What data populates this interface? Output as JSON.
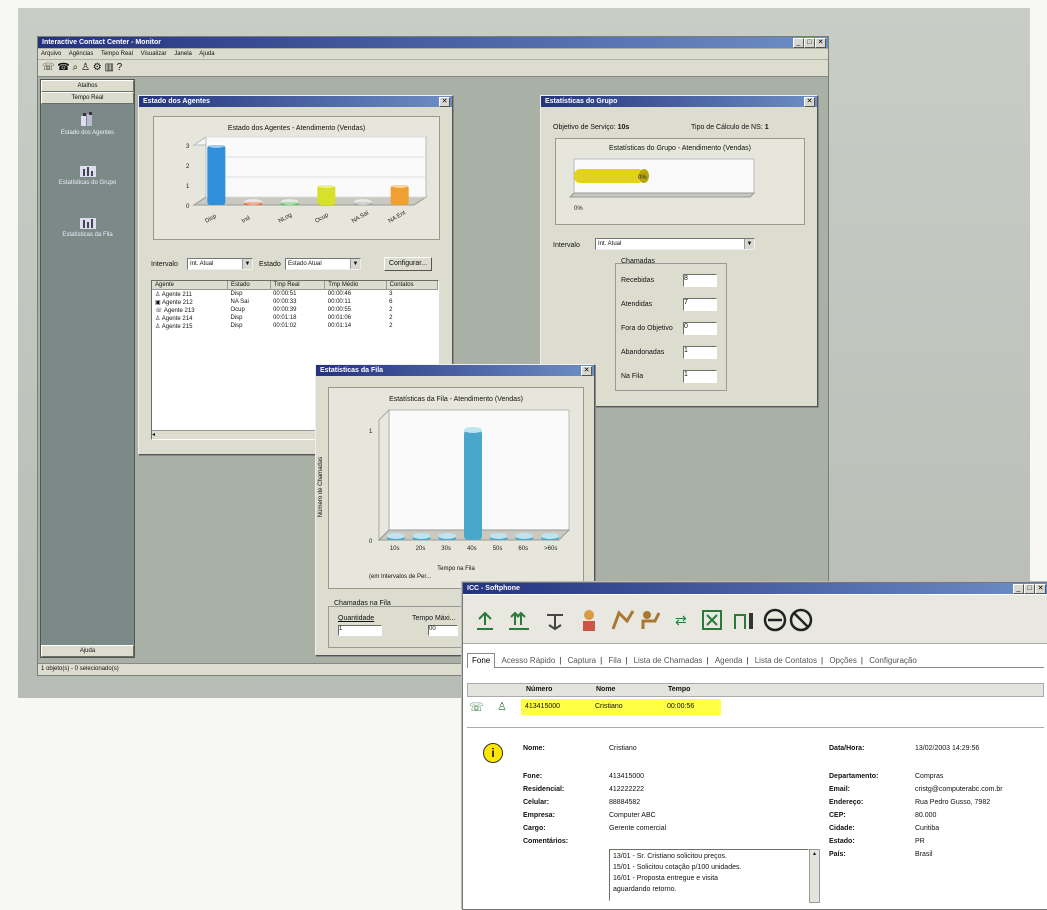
{
  "main_window": {
    "title": "Interactive Contact Center - Monitor",
    "menu": [
      "Arquivo",
      "Agências",
      "Tempo Real",
      "Visualizar",
      "Janela",
      "Ajuda"
    ],
    "sidebar": {
      "header": "Atalhos",
      "section": "Tempo Real",
      "items": [
        {
          "label": "Estado dos Agentes",
          "icon": "agents-icon"
        },
        {
          "label": "Estatísticas do Grupo",
          "icon": "group-stats-icon"
        },
        {
          "label": "Estatísticas da Fila",
          "icon": "queue-stats-icon"
        }
      ],
      "footer": "Ajuda"
    },
    "status_bar": "1 objeto(s) - 0 selecionado(s)"
  },
  "agents_window": {
    "title": "Estado dos Agentes",
    "interval_label": "Intervalo",
    "interval_value": "Int. Atual",
    "state_label": "Estado",
    "state_value": "Estado Atual",
    "configure_button": "Configurar...",
    "chart_data": {
      "type": "bar",
      "title": "Estado dos Agentes - Atendimento (Vendas)",
      "categories": [
        "Disp",
        "Ind",
        "NLog",
        "Ocup",
        "NA Sai",
        "NA Ent"
      ],
      "values": [
        3,
        0,
        0,
        1,
        0,
        1
      ],
      "ylim": [
        0,
        3
      ],
      "yticks": [
        "0",
        "1",
        "2",
        "3"
      ],
      "colors": [
        "#2f8fd8",
        "#e4531f",
        "#3fb84a",
        "#d8e02a",
        "#9a9a9a",
        "#f0a030"
      ]
    },
    "columns": [
      "Agente",
      "Estado",
      "Tmp Real",
      "Tmp Médio",
      "Contatos"
    ],
    "rows": [
      [
        "Agente 211",
        "Disp",
        "00:00:51",
        "00:00:46",
        "3"
      ],
      [
        "Agente 212",
        "NA Sai",
        "00:00:33",
        "00:00:11",
        "6"
      ],
      [
        "Agente 213",
        "Ocup",
        "00:00:39",
        "00:00:55",
        "2"
      ],
      [
        "Agente 214",
        "Disp",
        "00:01:18",
        "00:01:06",
        "2"
      ],
      [
        "Agente 215",
        "Disp",
        "00:01:02",
        "00:01:14",
        "2"
      ]
    ]
  },
  "group_window": {
    "title": "Estatísticas do Grupo",
    "objective_label": "Objetivo de Serviço:",
    "objective_value": "10s",
    "calc_label": "Tipo de Cálculo de NS:",
    "calc_value": "1",
    "chart_data": {
      "type": "bar",
      "title": "Estatísticas do Grupo - Atendimento (Vendas)",
      "categories": [
        ""
      ],
      "values": [
        0
      ],
      "bar_label": "0%",
      "axis_label": "0%"
    },
    "interval_label": "Intervalo",
    "interval_value": "Int. Atual",
    "calls_label": "Chamadas",
    "stats": [
      {
        "label": "Recebidas",
        "value": "8"
      },
      {
        "label": "Atendidas",
        "value": "7"
      },
      {
        "label": "Fora do Objetivo",
        "value": "0"
      },
      {
        "label": "Abandonadas",
        "value": "1"
      },
      {
        "label": "Na Fila",
        "value": "1"
      }
    ]
  },
  "queue_window": {
    "title": "Estatísticas da Fila",
    "chart_data": {
      "type": "bar",
      "title": "Estatísticas da Fila - Atendimento (Vendas)",
      "categories": [
        "10s",
        "20s",
        "30s",
        "40s",
        "50s",
        "60s",
        ">60s"
      ],
      "values": [
        0,
        0,
        0,
        1,
        0,
        0,
        0
      ],
      "ylim": [
        0,
        1
      ],
      "yticks": [
        "0",
        "1"
      ],
      "ylabel": "Número de Chamadas",
      "xlabel": "Tempo na Fila",
      "xlabel2": "(em Intervalos de Per..."
    },
    "calls_label": "Chamadas na Fila",
    "qty_label": "Quantidade",
    "qty_value": "1",
    "max_label": "Tempo Máxi...",
    "max_value": "00"
  },
  "softphone": {
    "title": "ICC - Softphone",
    "tabs": [
      "Fone",
      "Acesso Rápido",
      "Captura",
      "Fila",
      "Lista de Chamadas",
      "Agenda",
      "Lista de Contatos",
      "Opções",
      "Configuração"
    ],
    "call_columns": [
      "",
      "Número",
      "Nome",
      "Tempo"
    ],
    "call_row": {
      "number": "413415000",
      "name": "Cristiano",
      "time": "00:00:56"
    },
    "left_fields": [
      {
        "label": "Nome:",
        "value": "Cristiano"
      },
      {
        "label": "Fone:",
        "value": "413415000"
      },
      {
        "label": "Residencial:",
        "value": "412222222"
      },
      {
        "label": "Celular:",
        "value": "88884582"
      },
      {
        "label": "Empresa:",
        "value": "Computer ABC"
      },
      {
        "label": "Cargo:",
        "value": "Gerente comercial"
      },
      {
        "label": "Comentários:",
        "value": ""
      }
    ],
    "comments": [
      "13/01 - Sr. Cristiano solicitou preços.",
      "15/01 - Solicitou cotação p/100 unidades.",
      "16/01 - Proposta entregue e visita",
      "aguardando retorno."
    ],
    "right_fields": [
      {
        "label": "Data/Hora:",
        "value": "13/02/2003 14:29:56"
      },
      {
        "label": "Departamento:",
        "value": "Compras"
      },
      {
        "label": "Email:",
        "value": "cristg@computerabc.com.br"
      },
      {
        "label": "Endereço:",
        "value": "Rua Pedro Gusso, 7982"
      },
      {
        "label": "CEP:",
        "value": "80.000"
      },
      {
        "label": "Cidade:",
        "value": "Curitiba"
      },
      {
        "label": "Estado:",
        "value": "PR"
      },
      {
        "label": "País:",
        "value": "Brasil"
      }
    ]
  }
}
